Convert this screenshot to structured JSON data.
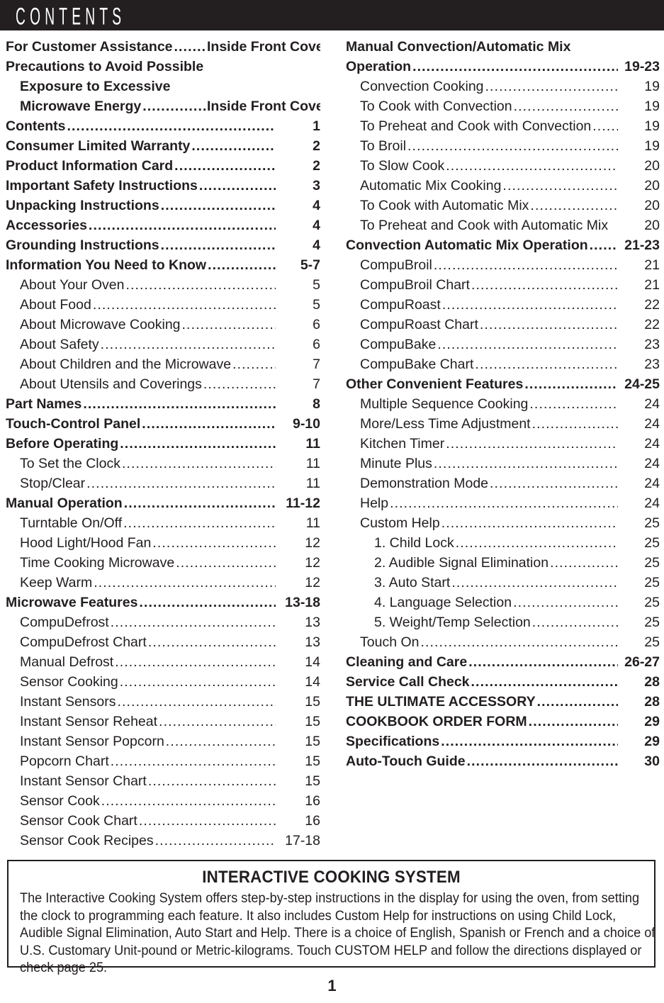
{
  "header": {
    "title": "CONTENTS"
  },
  "toc": {
    "left_column": [
      {
        "label": "For Customer Assistance",
        "page": "Inside Front Cover",
        "level": 0,
        "indent": 0,
        "leader": true,
        "num_width": 160
      },
      {
        "label": "Precautions to Avoid Possible",
        "page": "",
        "level": 0,
        "indent": 0,
        "leader": false
      },
      {
        "label": "Exposure to Excessive",
        "page": "",
        "level": 0,
        "indent": 1,
        "leader": false
      },
      {
        "label": "Microwave Energy",
        "page": "Inside Front Cover",
        "level": 0,
        "indent": 1,
        "leader": true,
        "num_width": 160
      },
      {
        "label": "Contents",
        "page": "1",
        "level": 0,
        "indent": 0,
        "leader": true
      },
      {
        "label": "Consumer Limited Warranty",
        "page": "2",
        "level": 0,
        "indent": 0,
        "leader": true
      },
      {
        "label": "Product Information Card",
        "page": "2",
        "level": 0,
        "indent": 0,
        "leader": true
      },
      {
        "label": "Important Safety Instructions",
        "page": "3",
        "level": 0,
        "indent": 0,
        "leader": true
      },
      {
        "label": "Unpacking Instructions",
        "page": "4",
        "level": 0,
        "indent": 0,
        "leader": true
      },
      {
        "label": "Accessories",
        "page": "4",
        "level": 0,
        "indent": 0,
        "leader": true
      },
      {
        "label": "Grounding Instructions",
        "page": "4",
        "level": 0,
        "indent": 0,
        "leader": true
      },
      {
        "label": "Information You Need to Know",
        "page": "5-7",
        "level": 0,
        "indent": 0,
        "leader": true
      },
      {
        "label": "About Your Oven",
        "page": "5",
        "level": 1,
        "indent": 1,
        "leader": true
      },
      {
        "label": "About Food",
        "page": "5",
        "level": 1,
        "indent": 1,
        "leader": true
      },
      {
        "label": "About Microwave Cooking",
        "page": "6",
        "level": 1,
        "indent": 1,
        "leader": true
      },
      {
        "label": "About Safety",
        "page": "6",
        "level": 1,
        "indent": 1,
        "leader": true
      },
      {
        "label": "About Children and the Microwave",
        "page": "7",
        "level": 1,
        "indent": 1,
        "leader": true
      },
      {
        "label": "About Utensils and Coverings",
        "page": "7",
        "level": 1,
        "indent": 1,
        "leader": true
      },
      {
        "label": "Part Names",
        "page": "8",
        "level": 0,
        "indent": 0,
        "leader": true
      },
      {
        "label": "Touch-Control Panel",
        "page": "9-10",
        "level": 0,
        "indent": 0,
        "leader": true
      },
      {
        "label": "Before Operating",
        "page": "11",
        "level": 0,
        "indent": 0,
        "leader": true
      },
      {
        "label": "To Set the Clock",
        "page": "11",
        "level": 1,
        "indent": 1,
        "leader": true
      },
      {
        "label": "Stop/Clear",
        "page": "11",
        "level": 1,
        "indent": 1,
        "leader": true
      },
      {
        "label": "Manual Operation",
        "page": "11-12",
        "level": 0,
        "indent": 0,
        "leader": true
      },
      {
        "label": "Turntable On/Off",
        "page": "11",
        "level": 1,
        "indent": 1,
        "leader": true
      },
      {
        "label": "Hood Light/Hood Fan",
        "page": "12",
        "level": 1,
        "indent": 1,
        "leader": true
      },
      {
        "label": "Time Cooking Microwave",
        "page": "12",
        "level": 1,
        "indent": 1,
        "leader": true
      },
      {
        "label": "Keep Warm",
        "page": "12",
        "level": 1,
        "indent": 1,
        "leader": true
      },
      {
        "label": "Microwave Features",
        "page": "13-18",
        "level": 0,
        "indent": 0,
        "leader": true
      },
      {
        "label": "CompuDefrost",
        "page": "13",
        "level": 1,
        "indent": 1,
        "leader": true
      },
      {
        "label": "CompuDefrost Chart",
        "page": "13",
        "level": 1,
        "indent": 1,
        "leader": true
      },
      {
        "label": "Manual Defrost",
        "page": "14",
        "level": 1,
        "indent": 1,
        "leader": true
      },
      {
        "label": "Sensor Cooking",
        "page": "14",
        "level": 1,
        "indent": 1,
        "leader": true
      },
      {
        "label": "Instant Sensors",
        "page": "15",
        "level": 1,
        "indent": 1,
        "leader": true
      },
      {
        "label": "Instant Sensor Reheat",
        "page": "15",
        "level": 1,
        "indent": 1,
        "leader": true
      },
      {
        "label": "Instant Sensor Popcorn",
        "page": "15",
        "level": 1,
        "indent": 1,
        "leader": true
      },
      {
        "label": "Popcorn Chart",
        "page": "15",
        "level": 1,
        "indent": 1,
        "leader": true
      },
      {
        "label": "Instant Sensor Chart",
        "page": "15",
        "level": 1,
        "indent": 1,
        "leader": true
      },
      {
        "label": "Sensor Cook",
        "page": "16",
        "level": 1,
        "indent": 1,
        "leader": true
      },
      {
        "label": "Sensor Cook Chart",
        "page": "16",
        "level": 1,
        "indent": 1,
        "leader": true
      },
      {
        "label": "Sensor Cook Recipes",
        "page": "17-18",
        "level": 1,
        "indent": 1,
        "leader": true
      }
    ],
    "right_column": [
      {
        "label": "Manual Convection/Automatic Mix",
        "page": "",
        "level": 0,
        "indent": 0,
        "leader": false
      },
      {
        "label": "Operation",
        "page": "19-23",
        "level": 0,
        "indent": 0,
        "leader": true
      },
      {
        "label": "Convection Cooking",
        "page": "19",
        "level": 1,
        "indent": 1,
        "leader": true
      },
      {
        "label": "To Cook with Convection",
        "page": "19",
        "level": 1,
        "indent": 1,
        "leader": true
      },
      {
        "label": "To Preheat and Cook with Convection",
        "page": "19",
        "level": 1,
        "indent": 1,
        "leader": true
      },
      {
        "label": "To Broil",
        "page": "19",
        "level": 1,
        "indent": 1,
        "leader": true
      },
      {
        "label": "To Slow Cook",
        "page": "20",
        "level": 1,
        "indent": 1,
        "leader": true
      },
      {
        "label": "Automatic Mix Cooking",
        "page": "20",
        "level": 1,
        "indent": 1,
        "leader": true
      },
      {
        "label": "To Cook with Automatic Mix",
        "page": "20",
        "level": 1,
        "indent": 1,
        "leader": true
      },
      {
        "label": "To Preheat and Cook with Automatic Mix",
        "page": "20",
        "level": 1,
        "indent": 1,
        "leader": false
      },
      {
        "label": "Convection Automatic Mix Operation",
        "page": "21-23",
        "level": 0,
        "indent": 0,
        "leader": true
      },
      {
        "label": "CompuBroil",
        "page": "21",
        "level": 1,
        "indent": 1,
        "leader": true
      },
      {
        "label": "CompuBroil Chart",
        "page": "21",
        "level": 1,
        "indent": 1,
        "leader": true
      },
      {
        "label": "CompuRoast",
        "page": "22",
        "level": 1,
        "indent": 1,
        "leader": true
      },
      {
        "label": "CompuRoast Chart",
        "page": "22",
        "level": 1,
        "indent": 1,
        "leader": true
      },
      {
        "label": "CompuBake",
        "page": "23",
        "level": 1,
        "indent": 1,
        "leader": true
      },
      {
        "label": "CompuBake Chart",
        "page": "23",
        "level": 1,
        "indent": 1,
        "leader": true
      },
      {
        "label": "Other Convenient Features",
        "page": "24-25",
        "level": 0,
        "indent": 0,
        "leader": true
      },
      {
        "label": "Multiple Sequence Cooking",
        "page": "24",
        "level": 1,
        "indent": 1,
        "leader": true
      },
      {
        "label": "More/Less Time Adjustment",
        "page": "24",
        "level": 1,
        "indent": 1,
        "leader": true
      },
      {
        "label": "Kitchen Timer",
        "page": "24",
        "level": 1,
        "indent": 1,
        "leader": true
      },
      {
        "label": "Minute Plus",
        "page": "24",
        "level": 1,
        "indent": 1,
        "leader": true
      },
      {
        "label": "Demonstration Mode",
        "page": "24",
        "level": 1,
        "indent": 1,
        "leader": true
      },
      {
        "label": "Help",
        "page": "24",
        "level": 1,
        "indent": 1,
        "leader": true
      },
      {
        "label": "Custom Help",
        "page": "25",
        "level": 1,
        "indent": 1,
        "leader": true
      },
      {
        "label": "1. Child Lock",
        "page": "25",
        "level": 1,
        "indent": 2,
        "leader": true
      },
      {
        "label": "2. Audible Signal Elimination",
        "page": "25",
        "level": 1,
        "indent": 2,
        "leader": true
      },
      {
        "label": "3. Auto Start",
        "page": "25",
        "level": 1,
        "indent": 2,
        "leader": true
      },
      {
        "label": "4. Language Selection",
        "page": "25",
        "level": 1,
        "indent": 2,
        "leader": true
      },
      {
        "label": "5. Weight/Temp Selection",
        "page": "25",
        "level": 1,
        "indent": 2,
        "leader": true
      },
      {
        "label": "Touch On",
        "page": "25",
        "level": 1,
        "indent": 1,
        "leader": true
      },
      {
        "label": "Cleaning and Care",
        "page": "26-27",
        "level": 0,
        "indent": 0,
        "leader": true
      },
      {
        "label": "Service Call Check",
        "page": "28",
        "level": 0,
        "indent": 0,
        "leader": true
      },
      {
        "label": "THE ULTIMATE ACCESSORY",
        "page": "28",
        "level": 0,
        "indent": 0,
        "leader": true
      },
      {
        "label": "COOKBOOK ORDER FORM",
        "page": "29",
        "level": 0,
        "indent": 0,
        "leader": true
      },
      {
        "label": "Specifications",
        "page": "29",
        "level": 0,
        "indent": 0,
        "leader": true
      },
      {
        "label": "Auto-Touch Guide",
        "page": "30",
        "level": 0,
        "indent": 0,
        "leader": true
      }
    ]
  },
  "interactive_box": {
    "title": "INTERACTIVE COOKING SYSTEM",
    "body": "The Interactive Cooking System offers step-by-step instructions in the display for using the oven, from setting the clock to programming each feature. It also includes Custom Help for instructions on using Child Lock, Audible Signal Elimination, Auto Start and Help. There is a choice of English, Spanish or French and a choice of U.S. Customary Unit-pound or Metric-kilograms. Touch CUSTOM HELP and follow the directions displayed or check page 25."
  },
  "footer": {
    "page_number": "1"
  },
  "colors": {
    "header_bar": "#231f20",
    "text": "#221e1f",
    "page_background": "#ffffff"
  }
}
